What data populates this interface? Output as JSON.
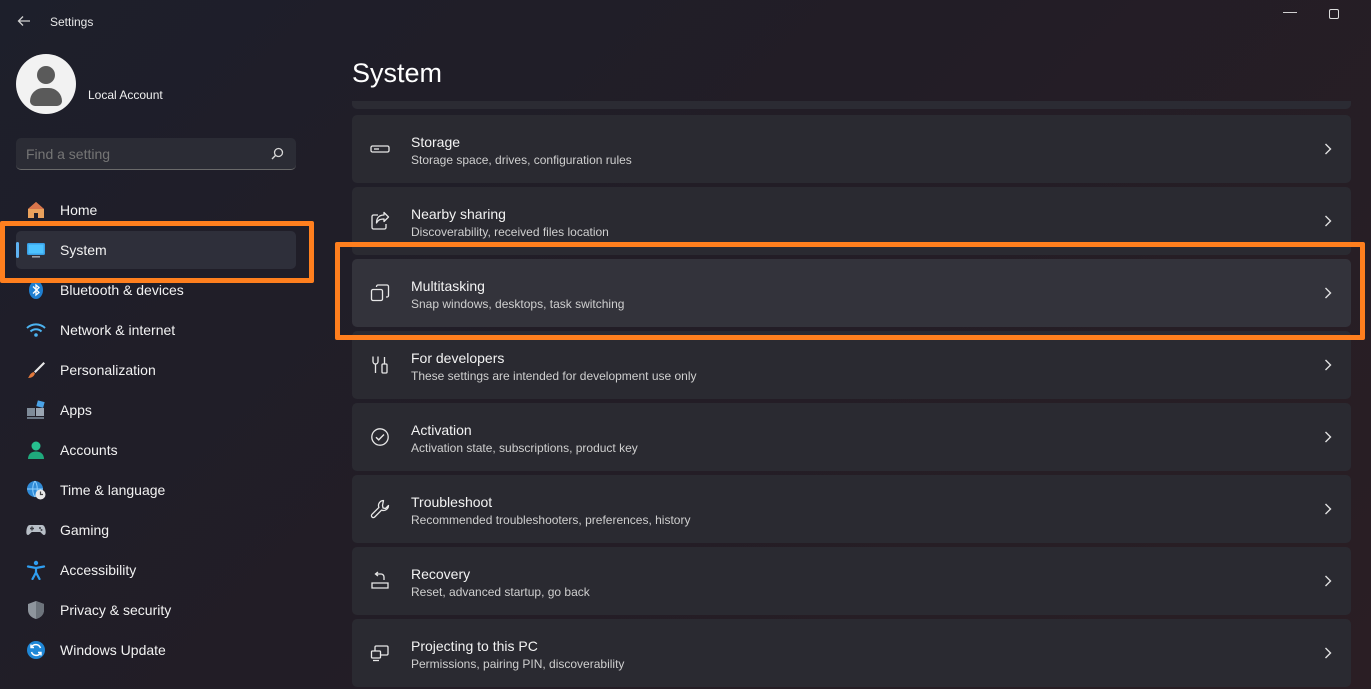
{
  "window": {
    "title": "Settings",
    "back_icon": "arrow-left-icon",
    "minimize_glyph": "—"
  },
  "account": {
    "name": "Local Account"
  },
  "search": {
    "placeholder": "Find a setting"
  },
  "nav": {
    "items": [
      {
        "label": "Home",
        "icon": "home-icon"
      },
      {
        "label": "System",
        "icon": "monitor-icon",
        "active": true
      },
      {
        "label": "Bluetooth & devices",
        "icon": "bluetooth-icon"
      },
      {
        "label": "Network & internet",
        "icon": "wifi-icon"
      },
      {
        "label": "Personalization",
        "icon": "brush-icon"
      },
      {
        "label": "Apps",
        "icon": "apps-icon"
      },
      {
        "label": "Accounts",
        "icon": "person-icon"
      },
      {
        "label": "Time & language",
        "icon": "globe-clock-icon"
      },
      {
        "label": "Gaming",
        "icon": "gamepad-icon"
      },
      {
        "label": "Accessibility",
        "icon": "accessibility-icon"
      },
      {
        "label": "Privacy & security",
        "icon": "shield-icon"
      },
      {
        "label": "Windows Update",
        "icon": "refresh-icon"
      }
    ]
  },
  "page": {
    "title": "System"
  },
  "settings": [
    {
      "title": "Storage",
      "description": "Storage space, drives, configuration rules",
      "icon": "storage-icon"
    },
    {
      "title": "Nearby sharing",
      "description": "Discoverability, received files location",
      "icon": "share-icon"
    },
    {
      "title": "Multitasking",
      "description": "Snap windows, desktops, task switching",
      "icon": "multitasking-icon",
      "highlighted": true
    },
    {
      "title": "For developers",
      "description": "These settings are intended for development use only",
      "icon": "developer-tools-icon"
    },
    {
      "title": "Activation",
      "description": "Activation state, subscriptions, product key",
      "icon": "check-circle-icon"
    },
    {
      "title": "Troubleshoot",
      "description": "Recommended troubleshooters, preferences, history",
      "icon": "wrench-icon"
    },
    {
      "title": "Recovery",
      "description": "Reset, advanced startup, go back",
      "icon": "recovery-icon"
    },
    {
      "title": "Projecting to this PC",
      "description": "Permissions, pairing PIN, discoverability",
      "icon": "projecting-icon"
    }
  ],
  "colors": {
    "accent": "#5fb2f2",
    "highlight_box": "#ff7f1e",
    "card": "#2a2a31"
  }
}
